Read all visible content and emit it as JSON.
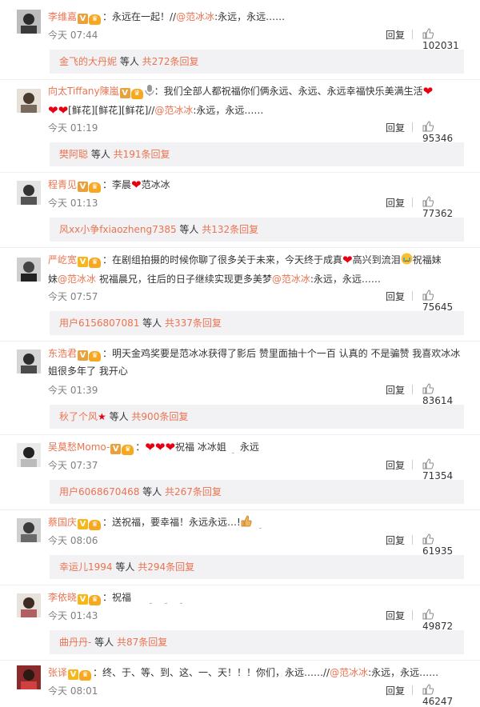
{
  "comments": [
    {
      "username": "李维嘉",
      "v_badge": "V",
      "crown_badge": "♛",
      "text": "：永远在一起！//",
      "mention": "@范冰冰",
      "after_mention": ":永远，永远……",
      "time": "今天 07:44",
      "reply_label": "回复",
      "likes": "102031",
      "sub_user": "金飞的大丹妮",
      "sub_mid": " 等人 ",
      "sub_count": "共272条回复"
    },
    {
      "username": "向太Tiffany陳嵐",
      "v_badge": "V",
      "crown_badge": "♛",
      "line1": "：我们全部人都祝福你们俩永远、永远、永远幸福快乐美满生活",
      "line2_pre": "[鲜花][鲜花][鲜花]//",
      "mention": "@范冰冰",
      "after_mention": ":永远，永远……",
      "time": "今天 01:19",
      "reply_label": "回复",
      "likes": "95346",
      "sub_user": "樊阿聪",
      "sub_mid": " 等人 ",
      "sub_count": "共191条回复"
    },
    {
      "username": "程青见",
      "v_badge": "V",
      "crown_badge": "♛",
      "text_pre": "：李晨",
      "text_post": "范冰冰",
      "time": "今天 01:13",
      "reply_label": "回复",
      "likes": "77362",
      "sub_user": "风xx小争fxiaozheng7385",
      "sub_mid": " 等人 ",
      "sub_count": "共132条回复"
    },
    {
      "username": "严屹宽",
      "v_badge": "V",
      "crown_badge": "♛",
      "line1_a": "：在剧组拍摄的时候你聊了很多关于未来，今天终于成真",
      "line1_b": "高兴到流泪",
      "line1_c": "祝福妹",
      "line2_a": "妹",
      "mention1": "@范冰冰",
      "line2_b": " 祝福晨兄，往后的日子继续实现更多美梦",
      "mention2": "@范冰冰",
      "after_mention": ":永远，永远……",
      "time": "今天 07:57",
      "reply_label": "回复",
      "likes": "75645",
      "sub_user": "用户6156807081",
      "sub_mid": " 等人 ",
      "sub_count": "共337条回复"
    },
    {
      "username": "东浩君",
      "v_badge": "V",
      "crown_badge": "♛",
      "line1": "：明天金鸡奖要是范冰冰获得了影后 赞里面抽十个一百 认真的 不是骗赞 我喜欢冰冰",
      "line2": "姐很多年了 我开心",
      "time": "今天 01:39",
      "reply_label": "回复",
      "likes": "83614",
      "sub_user": "秋了个风",
      "sub_star": "★",
      "sub_mid": " 等人 ",
      "sub_count": "共900条回复"
    },
    {
      "username": "吴莫愁Momo-",
      "v_badge": "V",
      "crown_badge": "♛",
      "text_pre": "：",
      "text_post": "祝福 冰冰姐",
      "text_tail": "永远",
      "time": "今天 07:37",
      "reply_label": "回复",
      "likes": "71354",
      "sub_user": "用户6068670468",
      "sub_mid": " 等人 ",
      "sub_count": "共267条回复"
    },
    {
      "username": "蔡国庆",
      "v_badge": "V",
      "crown_badge": "♛",
      "text": "：送祝福，要幸福！永远永远…!",
      "time": "今天 08:06",
      "reply_label": "回复",
      "likes": "61935",
      "sub_user": "幸运儿1994",
      "sub_mid": " 等人 ",
      "sub_count": "共294条回复"
    },
    {
      "username": "李依晓",
      "v_badge": "V",
      "crown_badge": "♛",
      "text": "：祝福",
      "time": "今天 01:43",
      "reply_label": "回复",
      "likes": "49872",
      "sub_user": "曲丹丹-",
      "sub_mid": " 等人 ",
      "sub_count": "共87条回复"
    },
    {
      "username": "张译",
      "v_badge": "V",
      "crown_badge": "♛",
      "text": "：终、于、等、到、这、一、天！！！你们，永远……//",
      "mention": "@范冰冰",
      "after_mention": ":永远，永远……",
      "time": "今天 08:01",
      "reply_label": "回复",
      "likes": "46247"
    }
  ]
}
